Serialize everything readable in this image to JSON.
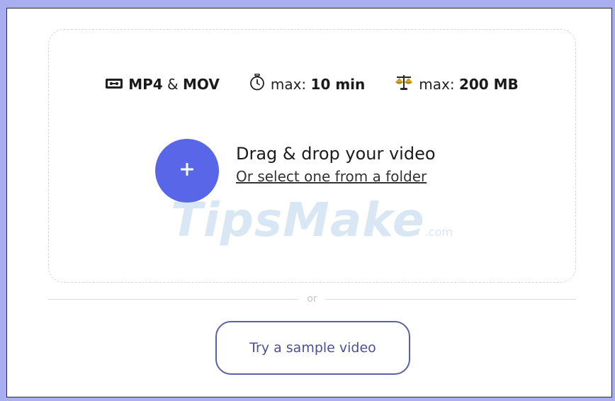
{
  "specs": {
    "format": {
      "icon": "video-cassette-icon",
      "label_a": "MP4",
      "amp": "&",
      "label_b": "MOV"
    },
    "duration": {
      "icon": "stopwatch-icon",
      "prefix": "max:",
      "value": "10 min"
    },
    "size": {
      "icon": "scales-icon",
      "prefix": "max:",
      "value": "200 MB"
    }
  },
  "upload": {
    "icon": "plus-icon",
    "title": "Drag & drop your video",
    "link": "Or select one from a folder"
  },
  "watermark": {
    "main": "TipsMake",
    "suffix": ".com"
  },
  "divider": {
    "text": "or"
  },
  "sample_button": {
    "label": "Try a sample video"
  },
  "colors": {
    "accent": "#5966e8",
    "button_border": "#5b5fa8",
    "page_background": "#a9aef0"
  }
}
